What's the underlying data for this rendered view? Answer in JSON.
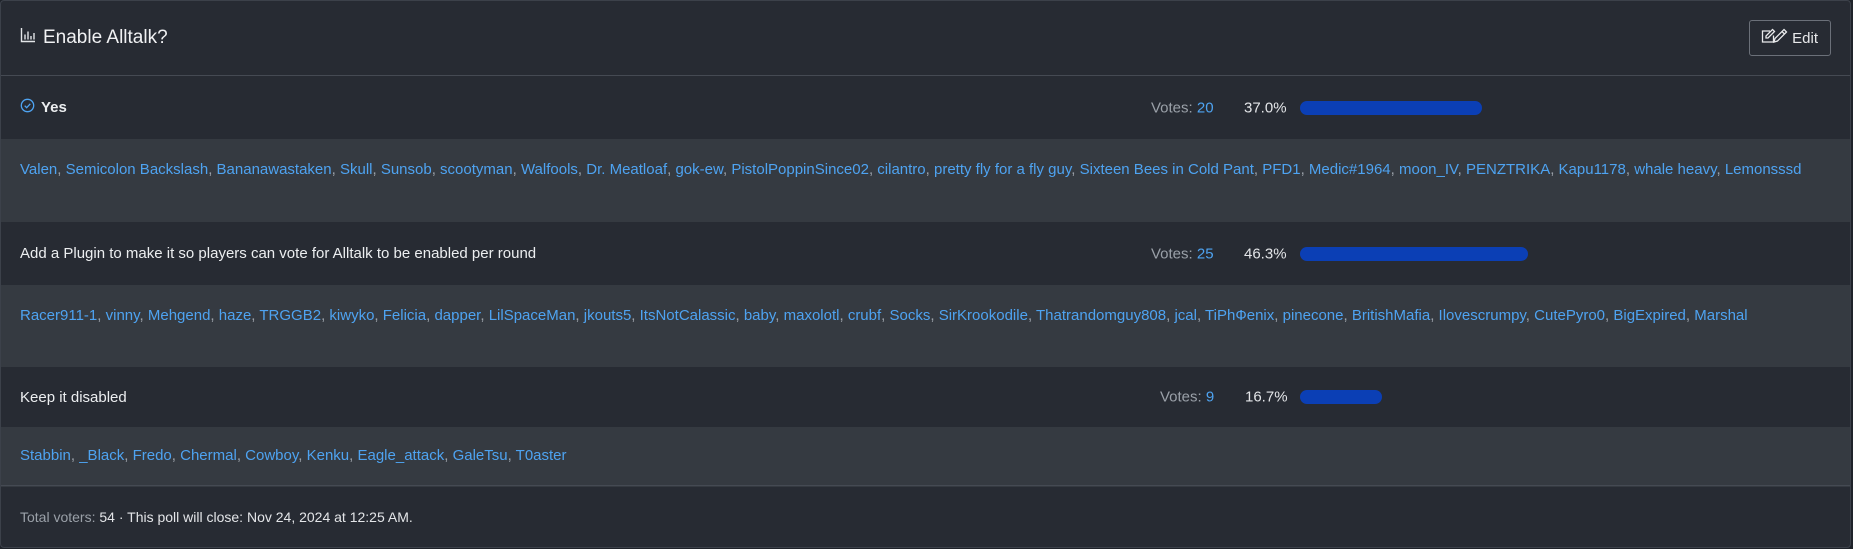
{
  "poll": {
    "title": "Enable Alltalk?",
    "edit_label": "Edit",
    "options": [
      {
        "label": "Yes",
        "selected": true,
        "votes_label": "Votes:",
        "votes": "20",
        "percent": "37.0%",
        "fraction": 0.37,
        "voters": [
          "Valen",
          "Semicolon Backslash",
          "Bananawastaken",
          "Skull",
          "Sunsob",
          "scootyman",
          "Walfools",
          "Dr. Meatloaf",
          "gok-ew",
          "PistolPoppinSince02",
          "cilantro",
          "pretty fly for a fly guy",
          "Sixteen Bees in Cold Pant",
          "PFD1",
          "Medic#1964",
          "moon_IV",
          "PENZTRIKA",
          "Kapu1178",
          "whale heavy",
          "Lemonsssd"
        ]
      },
      {
        "label": "Add a Plugin to make it so players can vote for Alltalk to be enabled per round",
        "selected": false,
        "votes_label": "Votes:",
        "votes": "25",
        "percent": "46.3%",
        "fraction": 0.463,
        "voters": [
          "Racer911-1",
          "vinny",
          "Mehgend",
          "haze",
          "TRGGB2",
          "kiwyko",
          "Felicia",
          "dapper",
          "LilSpaceMan",
          "jkouts5",
          "ItsNotCalassic",
          "baby",
          "maxolotl",
          "crubf",
          "Socks",
          "SirKrookodile",
          "Thatrandomguy808",
          "jcal",
          "TiPhФenix",
          "pinecone",
          "BritishMafia",
          "Ilovescrumpy",
          "CutePyro0",
          "BigExpired",
          "Marshal"
        ]
      },
      {
        "label": "Keep it disabled",
        "selected": false,
        "votes_label": "Votes:",
        "votes": "9",
        "percent": "16.7%",
        "fraction": 0.167,
        "voters": [
          "Stabbin",
          "_Black",
          "Fredo",
          "Chermal",
          "Cowboy",
          "Kenku",
          "Eagle_attack",
          "GaleTsu",
          "T0aster"
        ]
      }
    ],
    "footer": {
      "total_label": "Total voters:",
      "total": "54",
      "close_text": " · This poll will close: ",
      "close_date": "Nov 24, 2024 at 12:25 AM."
    }
  },
  "colors": {
    "accent": "#4ea3f1",
    "bar": "#0b3fb5"
  }
}
